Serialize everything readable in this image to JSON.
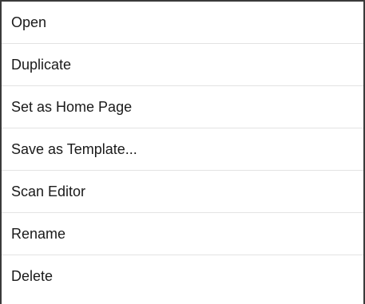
{
  "menu": {
    "items": [
      {
        "label": "Open"
      },
      {
        "label": "Duplicate"
      },
      {
        "label": "Set as Home Page"
      },
      {
        "label": "Save as Template..."
      },
      {
        "label": "Scan Editor"
      },
      {
        "label": "Rename"
      },
      {
        "label": "Delete"
      }
    ]
  }
}
